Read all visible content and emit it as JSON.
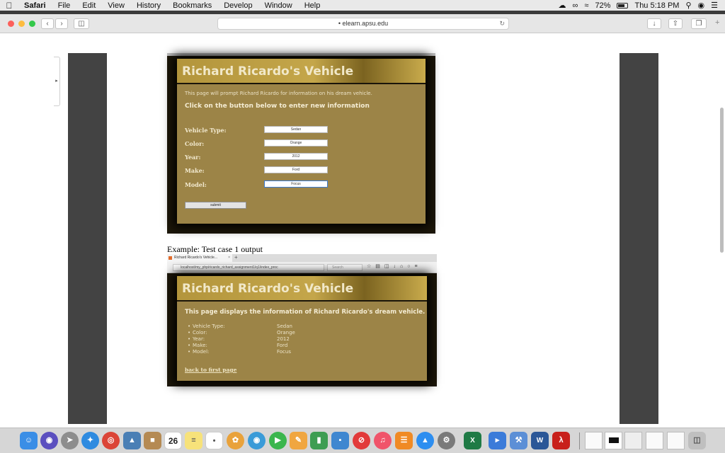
{
  "menubar": {
    "apple": "",
    "items": [
      "Safari",
      "File",
      "Edit",
      "View",
      "History",
      "Bookmarks",
      "Develop",
      "Window",
      "Help"
    ],
    "battery": "72%",
    "clock": "Thu 5:18 PM"
  },
  "browser": {
    "url": "elearn.apsu.edu"
  },
  "form_screenshot": {
    "title": "Richard Ricardo's Vehicle",
    "intro": "This page will prompt Richard Ricardo for information on his dream vehicle.",
    "heading": "Click on the button below to enter new information",
    "fields": [
      {
        "label": "Vehicle Type:",
        "value": "Sedan"
      },
      {
        "label": "Color:",
        "value": "Orange"
      },
      {
        "label": "Year:",
        "value": "2012"
      },
      {
        "label": "Make:",
        "value": "Ford"
      },
      {
        "label": "Model:",
        "value": "Focus"
      }
    ],
    "submit_label": "submit"
  },
  "caption": "Example: Test case 1 output",
  "output_screenshot": {
    "tab_title": "Richard Ricardo's Vehicle...",
    "tab_close": "×",
    "new_tab": "+",
    "url": "localhost/my_php/ricardo_richard_assignment1/q1/index_proc",
    "search_placeholder": "Search",
    "title": "Richard Ricardo's Vehicle",
    "heading": "This page displays the information of Richard Ricardo's dream vehicle.",
    "items": [
      {
        "label": "Vehicle Type:",
        "value": "Sedan"
      },
      {
        "label": "Color:",
        "value": "Orange"
      },
      {
        "label": "Year:",
        "value": "2012"
      },
      {
        "label": "Make:",
        "value": "Ford"
      },
      {
        "label": "Model:",
        "value": "Focus"
      }
    ],
    "link": "back to first page"
  },
  "dock": {
    "calendar_day": "26",
    "excel": "X",
    "word": "W"
  }
}
